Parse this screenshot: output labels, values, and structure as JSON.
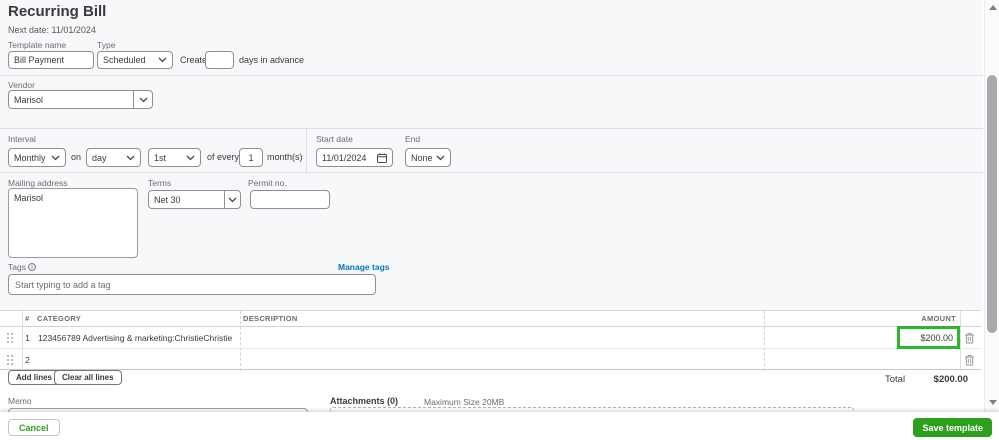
{
  "page": {
    "title": "Recurring Bill",
    "next_date": "Next date: 11/01/2024"
  },
  "template": {
    "name_label": "Template name",
    "name_value": "Bill Payment",
    "type_label": "Type",
    "type_value": "Scheduled",
    "create_label": "Create",
    "create_value": "",
    "days_label": "days in advance"
  },
  "vendor": {
    "label": "Vendor",
    "value": "Marisol"
  },
  "interval": {
    "label": "Interval",
    "frequency": "Monthly",
    "on_label": "on",
    "day_type": "day",
    "day_value": "1st",
    "of_every_label": "of every",
    "every_value": "1",
    "unit_label": "month(s)",
    "start_date_label": "Start date",
    "start_date_value": "11/01/2024",
    "end_label": "End",
    "end_value": "None"
  },
  "address": {
    "mailing_label": "Mailing address",
    "mailing_value": "Marisol",
    "terms_label": "Terms",
    "terms_value": "Net 30",
    "permit_label": "Permit no.",
    "permit_value": ""
  },
  "tags": {
    "label": "Tags",
    "manage_link": "Manage tags",
    "placeholder": "Start typing to add a tag"
  },
  "table": {
    "headers": {
      "number": "#",
      "category": "CATEGORY",
      "description": "DESCRIPTION",
      "amount": "AMOUNT"
    },
    "rows": [
      {
        "number": "1",
        "category": "123456789 Advertising & marketing:ChristieChristie",
        "description": "",
        "amount": "$200.00",
        "highlighted": true
      },
      {
        "number": "2",
        "category": "",
        "description": "",
        "amount": "",
        "highlighted": false
      }
    ],
    "add_lines_label": "Add lines",
    "clear_all_label": "Clear all lines",
    "total_label": "Total",
    "total_value": "$200.00"
  },
  "memo": {
    "label": "Memo"
  },
  "attachments": {
    "title": "Attachments (0)",
    "hint": "Maximum Size 20MB"
  },
  "footer": {
    "cancel_label": "Cancel",
    "save_label": "Save template"
  },
  "icons": {
    "chevron_down": "∨",
    "calendar": "▦",
    "info": "ⓘ",
    "drag_handle": "⠿",
    "trash": "🗑",
    "scroll_up": "▲",
    "scroll_down": "▼"
  },
  "colors": {
    "accent_green": "#2ca01c",
    "link_blue": "#0077c5",
    "highlight_green": "#29b829"
  }
}
